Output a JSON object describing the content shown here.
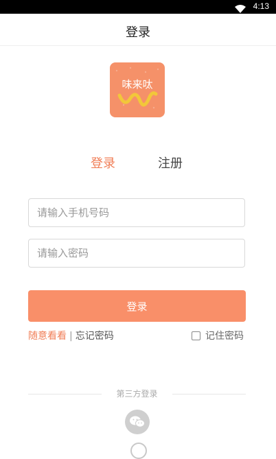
{
  "status_bar": {
    "time": "4:13",
    "icons": [
      "wifi-icon"
    ]
  },
  "app_bar": {
    "title": "登录"
  },
  "logo": {
    "text": "味来呔",
    "icon": "app-logo-icon",
    "color": "#f59169"
  },
  "tabs": [
    {
      "label": "登录",
      "active": true
    },
    {
      "label": "注册",
      "active": false
    }
  ],
  "form": {
    "phone_placeholder": "请输入手机号码",
    "password_placeholder": "请输入密码",
    "submit_label": "登录"
  },
  "links": {
    "browse": "随意看看",
    "separator": "|",
    "forgot": "忘记密码",
    "remember": "记住密码"
  },
  "third_party": {
    "label": "第三方登录",
    "icons": [
      "wechat-icon",
      "other-login-icon"
    ]
  },
  "colors": {
    "accent": "#f98f69",
    "accent_text": "#f07e57"
  }
}
